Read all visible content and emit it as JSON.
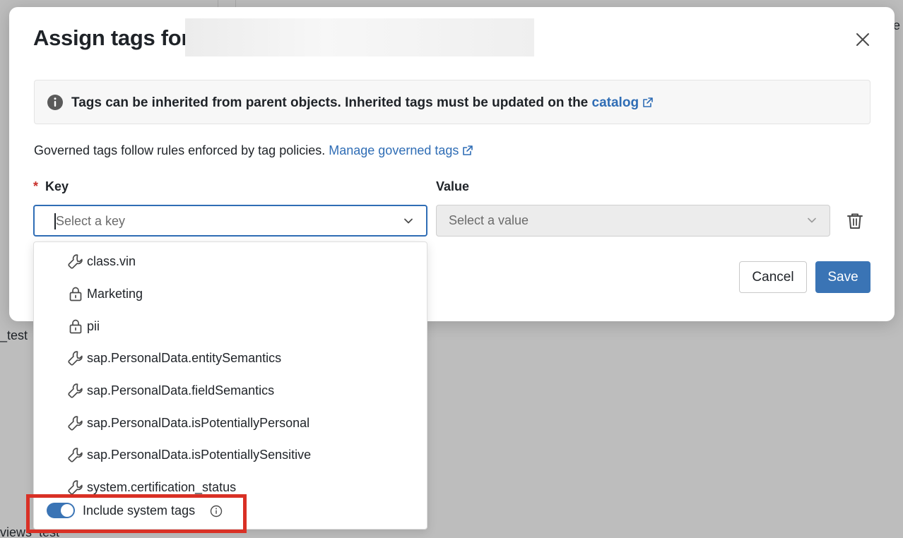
{
  "background": {
    "fragment_test": "_test",
    "fragment_views_test": "views_test",
    "fragment_e": "e"
  },
  "modal": {
    "title": "Assign tags for",
    "close_icon": "close-icon",
    "info": {
      "icon": "info-circle-icon",
      "text": "Tags can be inherited from parent objects. Inherited tags must be updated on the",
      "link_text": "catalog"
    },
    "governed": {
      "text": "Governed tags follow rules enforced by tag policies.",
      "link_text": "Manage governed tags"
    },
    "key": {
      "label": "Key",
      "required_marker": "*",
      "placeholder": "Select a key"
    },
    "value": {
      "label": "Value",
      "placeholder": "Select a value"
    },
    "delete_icon": "trash-icon",
    "cancel_label": "Cancel",
    "save_label": "Save"
  },
  "dropdown": {
    "items": [
      {
        "label": "class.vin",
        "icon": "wrench-icon"
      },
      {
        "label": "Marketing",
        "icon": "lock-icon"
      },
      {
        "label": "pii",
        "icon": "lock-icon"
      },
      {
        "label": "sap.PersonalData.entitySemantics",
        "icon": "wrench-icon"
      },
      {
        "label": "sap.PersonalData.fieldSemantics",
        "icon": "wrench-icon"
      },
      {
        "label": "sap.PersonalData.isPotentiallyPersonal",
        "icon": "wrench-icon"
      },
      {
        "label": "sap.PersonalData.isPotentiallySensitive",
        "icon": "wrench-icon"
      },
      {
        "label": "system.certification_status",
        "icon": "wrench-icon"
      }
    ],
    "system_tags_toggle": {
      "label": "Include system tags",
      "on": true
    }
  },
  "colors": {
    "accent": "#3a74b5",
    "link": "#2f6db5",
    "required": "#c8302c",
    "highlight": "#d93025"
  }
}
